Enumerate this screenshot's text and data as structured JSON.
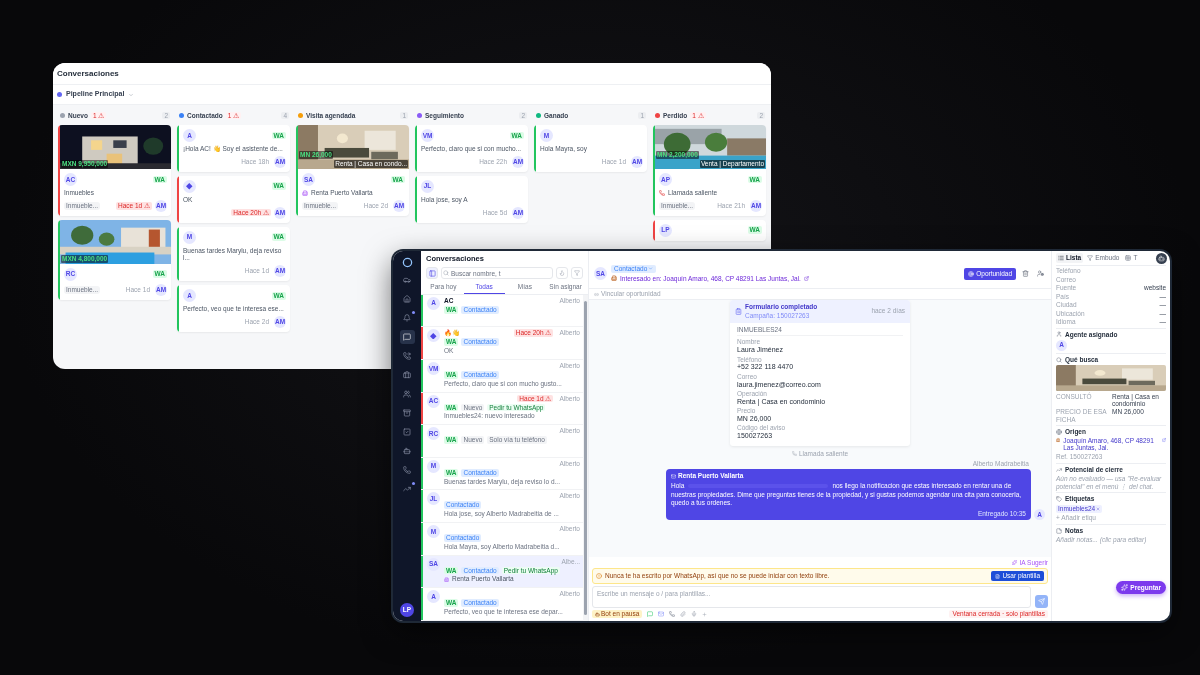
{
  "board": {
    "title": "Conversaciones",
    "pipeline": {
      "name": "Pipeline Principal",
      "color": "#6366f1"
    },
    "columns": [
      {
        "name": "Nuevo",
        "color": "#9ca3af",
        "alert": "1 ⚠",
        "count": "2",
        "cards": [
          {
            "price": "MXN 9,950,000",
            "initials": "AC",
            "channel": "WA",
            "text": "Inmuebles",
            "tag": "Inmueble...",
            "time": "Hace 1d ⚠",
            "urgent": true,
            "agent": "AM",
            "color": "#ef4444"
          },
          {
            "price": "MXN 4,800,000",
            "initials": "RC",
            "channel": "WA",
            "tag": "Inmueble...",
            "time": "Hace 1d",
            "urgent": false,
            "agent": "AM",
            "color": "#22c55e"
          }
        ]
      },
      {
        "name": "Contactado",
        "color": "#3b82f6",
        "alert": "1 ⚠",
        "count": "4",
        "cards": [
          {
            "kind": "plain",
            "initials": "A",
            "channel": "WA",
            "text": "¡Hola AC! 👋 Soy el asistente de...",
            "time": "Hace 18h",
            "urgent": false,
            "agent": "AM",
            "color": "#22c55e"
          },
          {
            "kind": "plain",
            "channel": "WA",
            "text": "OK",
            "time": "Hace 20h ⚠",
            "urgent": true,
            "agent": "AM",
            "color": "#ef4444"
          },
          {
            "kind": "plain",
            "initials": "M",
            "channel": "WA",
            "text": "Buenas tardes Marylu, deja reviso l...",
            "time": "Hace 1d",
            "urgent": false,
            "agent": "AM",
            "color": "#22c55e"
          },
          {
            "kind": "plain",
            "initials": "A",
            "channel": "WA",
            "text": "Perfecto, veo que te interesa ese...",
            "time": "Hace 2d",
            "urgent": false,
            "agent": "AM",
            "color": "#22c55e"
          }
        ]
      },
      {
        "name": "Visita agendada",
        "color": "#f59e0b",
        "count": "1",
        "cards": [
          {
            "price": "MN 26,000",
            "photo_tag": "Renta | Casa en condo...",
            "initials": "SA",
            "channel": "WA",
            "note": {
              "kind": "listing",
              "text": "Renta Puerto Vallarta"
            },
            "tag": "Inmueble...",
            "time": "Hace 2d",
            "urgent": false,
            "agent": "AM",
            "color": "#22c55e"
          }
        ]
      },
      {
        "name": "Seguimiento",
        "color": "#8b5cf6",
        "count": "2",
        "cards": [
          {
            "kind": "plain",
            "initials": "VM",
            "channel": "WA",
            "text": "Perfecto, claro que si con mucho...",
            "time": "Hace 22h",
            "urgent": false,
            "agent": "AM",
            "color": "#22c55e"
          },
          {
            "kind": "plain",
            "initials": "JL",
            "text": "Hola jose, soy A",
            "time": "Hace 5d",
            "urgent": false,
            "agent": "AM",
            "color": "#22c55e"
          }
        ]
      },
      {
        "name": "Ganado",
        "color": "#10b981",
        "count": "1",
        "cards": [
          {
            "kind": "plain",
            "initials": "M",
            "text": "Hola Mayra, soy",
            "time": "Hace 1d",
            "urgent": false,
            "agent": "AM",
            "color": "#22c55e"
          }
        ]
      },
      {
        "name": "Perdido",
        "color": "#ef4444",
        "alert": "1 ⚠",
        "count": "2",
        "cards": [
          {
            "price": "MN 2,200,000",
            "photo_tag": "Venta | Departamento",
            "initials": "AP",
            "channel": "WA",
            "note": {
              "kind": "call",
              "text": "Llamada saliente"
            },
            "tag": "Inmueble...",
            "time": "Hace 21h",
            "urgent": false,
            "agent": "AM",
            "color": "#22c55e"
          },
          {
            "kind": "plain",
            "initials": "LP",
            "channel": "WA",
            "color": "#ef4444"
          }
        ]
      }
    ]
  },
  "inbox": {
    "nav": [
      {
        "selected": false,
        "dot": false
      },
      {
        "selected": false,
        "dot": false
      },
      {
        "selected": false,
        "dot": true
      },
      {
        "selected": true,
        "dot": false
      },
      {
        "selected": false,
        "dot": false
      },
      {
        "selected": false,
        "dot": false
      },
      {
        "selected": false,
        "dot": false
      },
      {
        "selected": false,
        "dot": false
      },
      {
        "selected": false,
        "dot": false
      },
      {
        "selected": false,
        "dot": false
      },
      {
        "selected": false,
        "dot": false
      },
      {
        "selected": false,
        "dot": true
      }
    ],
    "user": "LP",
    "title": "Conversaciones",
    "search": {
      "placeholder": "Buscar nombre, t"
    },
    "tabs": [
      {
        "label": "Para hoy",
        "selected": false
      },
      {
        "label": "Todas",
        "selected": true
      },
      {
        "label": "Mías",
        "selected": false
      },
      {
        "label": "Sin asignar",
        "selected": false
      }
    ],
    "conversations": [
      {
        "initials": "A",
        "name": "AC",
        "badges": [
          {
            "label": "WA",
            "kind": "channel"
          },
          {
            "label": "Contactado",
            "kind": "stage"
          }
        ],
        "agent": "Alberto",
        "color": "#22c55e",
        "selected": false
      },
      {
        "name": "🔥👋",
        "alert": "Hace 20h ⚠",
        "badges": [
          {
            "label": "WA",
            "kind": "channel"
          },
          {
            "label": "Contactado",
            "kind": "stage"
          }
        ],
        "preview": "OK",
        "agent": "Alberto",
        "color": "#ef4444",
        "selected": false
      },
      {
        "initials": "VM",
        "badges": [
          {
            "label": "WA",
            "kind": "channel"
          },
          {
            "label": "Contactado",
            "kind": "stage"
          }
        ],
        "preview": "Perfecto, claro que si con mucho gusto...",
        "agent": "Alberto",
        "color": "#22c55e",
        "selected": false
      },
      {
        "initials": "AC",
        "alert": "Hace 1d ⚠",
        "badges": [
          {
            "label": "WA",
            "kind": "channel"
          },
          {
            "label": "Nuevo",
            "kind": "neutral"
          },
          {
            "label": "Pedir tu WhatsApp",
            "kind": "action"
          }
        ],
        "preview": "Inmuebles24: nuevo interesado",
        "agent": "Alberto",
        "color": "#ef4444",
        "selected": false
      },
      {
        "initials": "RC",
        "badges": [
          {
            "label": "WA",
            "kind": "channel"
          },
          {
            "label": "Nuevo",
            "kind": "neutral"
          },
          {
            "label": "Solo vía tu teléfono",
            "kind": "neutral"
          }
        ],
        "agent": "Alberto",
        "color": "#22c55e",
        "selected": false
      },
      {
        "initials": "M",
        "badges": [
          {
            "label": "WA",
            "kind": "channel"
          },
          {
            "label": "Contactado",
            "kind": "stage"
          }
        ],
        "preview": "Buenas tardes Marylu, deja reviso lo d...",
        "agent": "Alberto",
        "color": "#22c55e",
        "selected": false
      },
      {
        "initials": "JL",
        "badges": [
          {
            "label": "Contactado",
            "kind": "stage"
          }
        ],
        "preview": "Hola jose, soy Alberto Madrabeitia de ...",
        "agent": "Alberto",
        "color": "#22c55e",
        "selected": false
      },
      {
        "initials": "M",
        "badges": [
          {
            "label": "Contactado",
            "kind": "stage"
          }
        ],
        "preview": "Hola Mayra, soy Alberto Madrabeitia d...",
        "agent": "Alberto",
        "color": "#22c55e",
        "selected": false
      },
      {
        "initials": "SA",
        "badges": [
          {
            "label": "WA",
            "kind": "channel"
          },
          {
            "label": "Contactado",
            "kind": "stage"
          },
          {
            "label": "Pedir tu WhatsApp",
            "kind": "action"
          }
        ],
        "note": {
          "kind": "listing",
          "text": "Renta Puerto Vallarta"
        },
        "agent": "Albe...",
        "color": "#22c55e",
        "selected": true
      },
      {
        "initials": "A",
        "badges": [
          {
            "label": "WA",
            "kind": "channel"
          },
          {
            "label": "Contactado",
            "kind": "stage"
          }
        ],
        "preview": "Perfecto, veo que te interesa ese depar...",
        "agent": "Alberto",
        "color": "#22c55e",
        "selected": false
      }
    ],
    "chat": {
      "initials": "SA",
      "stage": "Contactado",
      "interest": "Interesado en: Joaquín Amaro, 468, CP 48291 Las Juntas, Jal.",
      "primary_button": "Oportunidad",
      "link": "Vincular oportunidad",
      "form": {
        "title": "Formulario completado",
        "subtitle": "Campaña: 150027263",
        "time": "hace 2 días",
        "source": "INMUEBLES24",
        "fields": [
          {
            "label": "Nombre",
            "value": "Laura Jiménez"
          },
          {
            "label": "Teléfono",
            "value": "+52 322 118 4470"
          },
          {
            "label": "Correo",
            "value": "laura.jimenez@correo.com"
          },
          {
            "label": "Operación",
            "value": "Renta | Casa en condominio"
          },
          {
            "label": "Precio",
            "value": "MN 26,000"
          },
          {
            "label": "Código del aviso",
            "value": "150027263"
          }
        ]
      },
      "event": "Llamada saliente",
      "sender": "Alberto Madrabeitia",
      "message": {
        "title": "Renta Puerto Vallarta",
        "greeting": "Hola",
        "body": "nos llego la notificacion que estas interesado en rentar una de nuestras propiedades. Dime que preguntas tienes de la propiedad, y si gustas podemos agendar una cita para conocerla, quedo a tus ordenes.",
        "status": "Entregado",
        "time": "10:35",
        "initials": "A"
      },
      "suggest": "IA Sugerir",
      "warning": "Nunca te ha escrito por WhatsApp, así que no se puede iniciar con texto libre.",
      "template_button": "Usar plantilla",
      "composer": {
        "placeholder": "Escribe un mensaje o / para plantillas..."
      },
      "bot_status": "Bot en pausa",
      "window_status": "Ventana cerrada · solo plantillas"
    },
    "details": {
      "tabs": [
        {
          "label": "Lista",
          "selected": true
        },
        {
          "label": "Embudo",
          "selected": false
        },
        {
          "label": "T",
          "selected": false
        }
      ],
      "fields": [
        {
          "label": "Teléfono"
        },
        {
          "label": "Correo"
        },
        {
          "label": "Fuente",
          "value": "website"
        },
        {
          "label": "País",
          "value": "—"
        },
        {
          "label": "Ciudad",
          "value": "—"
        },
        {
          "label": "Ubicación",
          "value": "—"
        },
        {
          "label": "Idioma",
          "value": "—"
        }
      ],
      "agent": {
        "title": "Agente asignado",
        "initials": "A"
      },
      "wants": {
        "title": "Qué busca",
        "rows": [
          {
            "label": "CONSULTÓ",
            "value": "Renta | Casa en condominio"
          },
          {
            "label": "PRECIO DE ESA FICHA",
            "value": "MN 26,000"
          }
        ]
      },
      "origin": {
        "title": "Origen",
        "address": "Joaquín Amaro, 468, CP 48291 Las Juntas, Jal.",
        "ref": "Ref. 150027263"
      },
      "potential": {
        "title": "Potencial de cierre",
        "note": "Aún no evaluado — usa \"Re-evaluar potencial\" en el menú ⋮ del chat."
      },
      "tags": {
        "title": "Etiquetas",
        "items": [
          "Inmuebles24"
        ],
        "add": "+ Añadir etiqu"
      },
      "notes": {
        "title": "Notas",
        "placeholder": "Añadir notas... (clic para editar)"
      },
      "ask_button": "Preguntar"
    }
  }
}
